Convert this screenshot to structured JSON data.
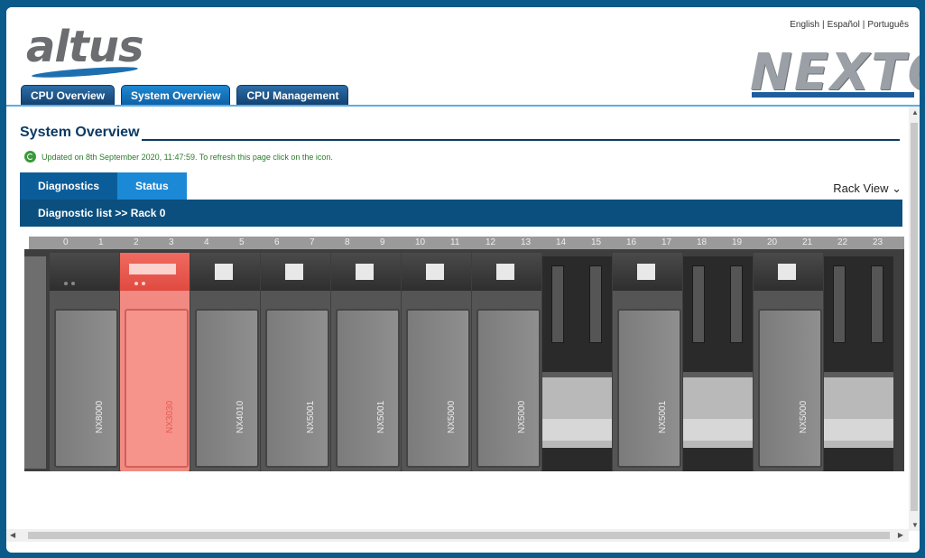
{
  "header": {
    "logo_text": "altus",
    "brand_text": "NEXTO",
    "languages": [
      "English",
      "Español",
      "Português"
    ],
    "tabs": [
      {
        "label": "CPU Overview"
      },
      {
        "label": "System Overview",
        "active": true
      },
      {
        "label": "CPU Management"
      }
    ]
  },
  "main": {
    "title": "System Overview",
    "refresh_text": "Updated on 8th September 2020, 11:47:59. To refresh this page click on the icon.",
    "subtabs": [
      {
        "label": "Diagnostics",
        "active": true
      },
      {
        "label": "Status"
      }
    ],
    "view_selector": "Rack View",
    "breadcrumb": "Diagnostic list >> Rack 0"
  },
  "rack": {
    "slot_numbers": [
      "0",
      "1",
      "2",
      "3",
      "4",
      "5",
      "6",
      "7",
      "8",
      "9",
      "10",
      "11",
      "12",
      "13",
      "14",
      "15",
      "16",
      "17",
      "18",
      "19",
      "20",
      "21",
      "22",
      "23"
    ],
    "modules": [
      {
        "label": "NX8000",
        "state": "ok"
      },
      {
        "label": "NX3030",
        "state": "error"
      },
      {
        "label": "NX4010",
        "state": "ok"
      },
      {
        "label": "NX5001",
        "state": "ok"
      },
      {
        "label": "NX5001",
        "state": "ok"
      },
      {
        "label": "NX5000",
        "state": "ok"
      },
      {
        "label": "NX5000",
        "state": "ok"
      },
      {
        "label": "",
        "state": "empty"
      },
      {
        "label": "NX5001",
        "state": "ok"
      },
      {
        "label": "",
        "state": "empty"
      },
      {
        "label": "NX5000",
        "state": "ok"
      },
      {
        "label": "",
        "state": "empty"
      }
    ]
  },
  "colors": {
    "accent": "#0b5d99",
    "error": "#f08a82",
    "ok_text": "#2b7a2b"
  }
}
